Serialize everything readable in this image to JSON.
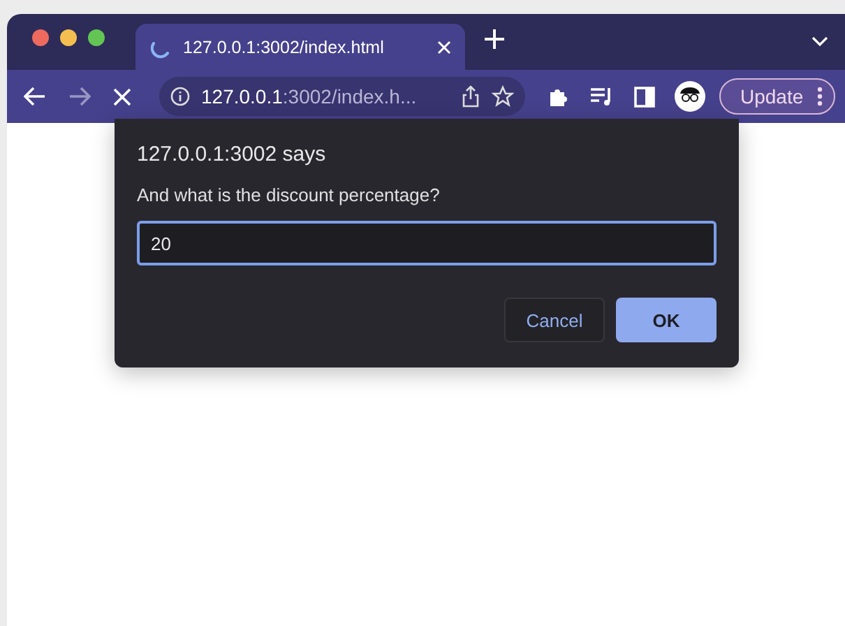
{
  "tab": {
    "title": "127.0.0.1:3002/index.html",
    "loading": true
  },
  "toolbar": {
    "url_host": "127.0.0.1",
    "url_rest": ":3002/index.h...",
    "update_button": "Update"
  },
  "dialog": {
    "title": "127.0.0.1:3002 says",
    "message": "And what is the discount percentage?",
    "value": "20",
    "buttons": [
      {
        "label": "Cancel",
        "kind": "secondary"
      },
      {
        "label": "OK",
        "kind": "primary"
      }
    ]
  }
}
